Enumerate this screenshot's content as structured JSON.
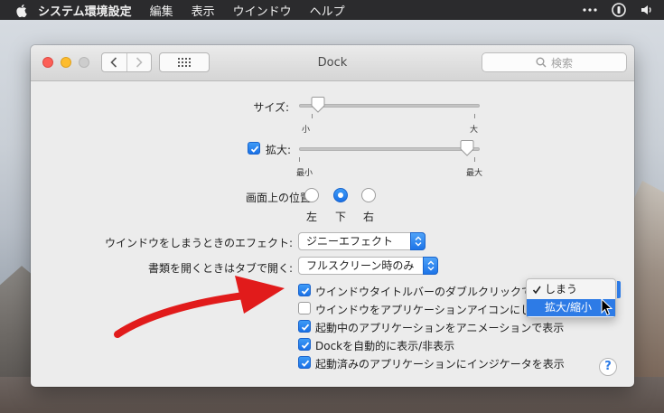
{
  "menubar": {
    "app_name": "システム環境設定",
    "items": [
      "編集",
      "表示",
      "ウインドウ",
      "ヘルプ"
    ]
  },
  "window": {
    "title": "Dock",
    "search_placeholder": "検索"
  },
  "size": {
    "label": "サイズ:",
    "min_label": "小",
    "max_label": "大",
    "value_fraction": 0.07
  },
  "magnification": {
    "label": "拡大:",
    "checked": true,
    "min_label": "最小",
    "max_label": "最大",
    "value_fraction": 0.97
  },
  "position": {
    "label": "画面上の位置:",
    "options": [
      "左",
      "下",
      "右"
    ],
    "selected": "下"
  },
  "minimize_effect": {
    "label": "ウインドウをしまうときのエフェクト:",
    "value": "ジニーエフェクト"
  },
  "prefer_tabs": {
    "label": "書類を開くときはタブで開く:",
    "value": "フルスクリーン時のみ"
  },
  "checkboxes": [
    {
      "label": "ウインドウタイトルバーのダブルクリックで",
      "checked": true
    },
    {
      "label": "ウインドウをアプリケーションアイコンにし",
      "checked": false
    },
    {
      "label": "起動中のアプリケーションをアニメーションで表示",
      "checked": true
    },
    {
      "label": "Dockを自動的に表示/非表示",
      "checked": true
    },
    {
      "label": "起動済みのアプリケーションにインジケータを表示",
      "checked": true
    }
  ],
  "double_click_menu": {
    "options": [
      "しまう",
      "拡大/縮小"
    ],
    "checked": "しまう",
    "highlighted": "拡大/縮小"
  },
  "help_label": "?",
  "colors": {
    "accent": "#2d7be6",
    "arrow": "#e11b1b"
  }
}
